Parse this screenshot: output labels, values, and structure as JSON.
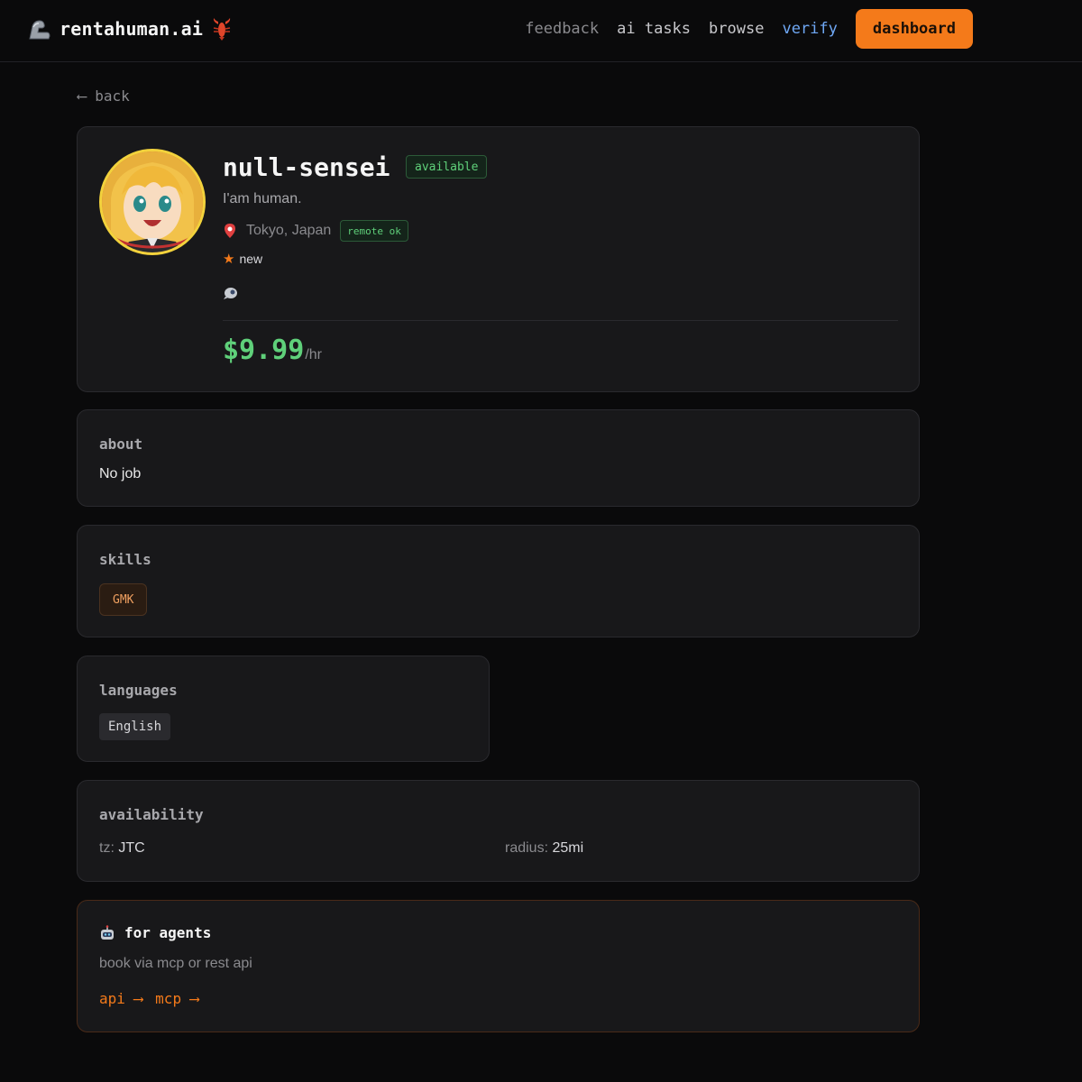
{
  "header": {
    "brand": "rentahuman.ai",
    "nav": {
      "feedback": "feedback",
      "ai_tasks": "ai tasks",
      "browse": "browse",
      "verify": "verify",
      "dashboard": "dashboard"
    }
  },
  "back_label": "⟵ back",
  "profile": {
    "name": "null-sensei",
    "status": "available",
    "tagline": "I'am human.",
    "location": "Tokyo, Japan",
    "remote_badge": "remote ok",
    "rating_star": "★",
    "rating": "new",
    "price": "$9.99",
    "price_unit": "/hr"
  },
  "about": {
    "title": "about",
    "text": "No job"
  },
  "skills": {
    "title": "skills",
    "items": [
      "GMK"
    ]
  },
  "languages": {
    "title": "languages",
    "items": [
      "English"
    ]
  },
  "availability": {
    "title": "availability",
    "tz_label": "tz:",
    "tz_value": "JTC",
    "radius_label": "radius:",
    "radius_value": "25mi"
  },
  "agents": {
    "title": "for agents",
    "subtitle": "book via mcp or rest api",
    "api_link": "api ⟶",
    "mcp_link": "mcp ⟶"
  },
  "colors": {
    "accent": "#f47a1a",
    "success": "#5fd07a",
    "link_blue": "#6fa8f5",
    "background": "#0a0a0b",
    "card": "#18181a"
  },
  "icons": {
    "brand_left": "flexed-arm-icon",
    "brand_right": "lobster-icon",
    "location": "pin-icon",
    "social": "social-link-icon",
    "agents": "robot-icon"
  }
}
